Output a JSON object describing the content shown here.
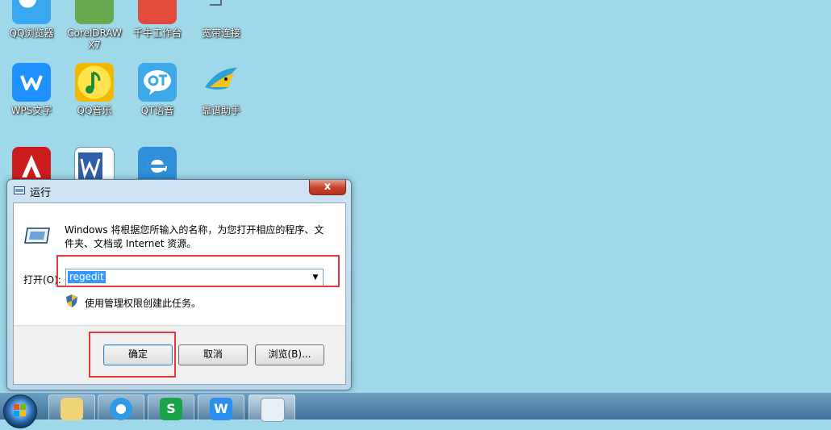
{
  "desktop": {
    "icons": [
      {
        "label": "QQ浏览器"
      },
      {
        "label": "CorelDRAW X7"
      },
      {
        "label": "千牛工作台"
      },
      {
        "label": "宽带连接"
      },
      {
        "label": "WPS文字"
      },
      {
        "label": "QQ音乐"
      },
      {
        "label": "QT语音"
      },
      {
        "label": "靠谱助手"
      }
    ]
  },
  "dialog": {
    "title": "运行",
    "close_glyph": "x",
    "description": "Windows 将根据您所输入的名称，为您打开相应的程序、文件夹、文档或 Internet 资源。",
    "open_label": "打开(O):",
    "open_value": "regedit",
    "admin_text": "使用管理权限创建此任务。",
    "ok_label": "确定",
    "cancel_label": "取消",
    "browse_label": "浏览(B)..."
  },
  "taskbar": {
    "wps_s_glyph": "S",
    "wps_w_glyph": "W"
  },
  "colors": {
    "desktop_bg": "#9ed8e9",
    "highlight": "#e53a3a",
    "selection": "#3399ff"
  }
}
